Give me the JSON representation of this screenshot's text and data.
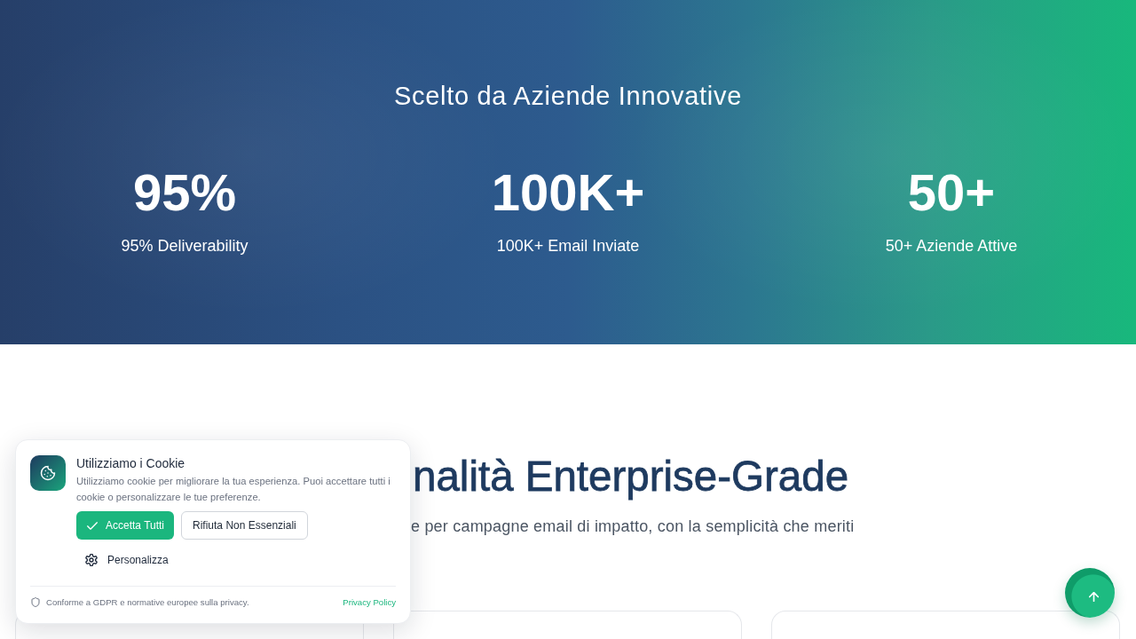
{
  "stats_section": {
    "title": "Scelto da Aziende Innovative",
    "stats": [
      {
        "value": "95%",
        "label": "95% Deliverability"
      },
      {
        "value": "100K+",
        "label": "100K+ Email Inviate"
      },
      {
        "value": "50+",
        "label": "50+ Aziende Attive"
      }
    ]
  },
  "features_section": {
    "title": "nalità Enterprise-Grade",
    "subtitle": "e per campagne email di impatto, con la semplicità che meriti"
  },
  "cookie_banner": {
    "title": "Utilizziamo i Cookie",
    "message": "Utilizziamo cookie per migliorare la tua esperienza. Puoi accettare tutti i cookie o personalizzare le tue preferenze.",
    "buttons": [
      {
        "label": "Accetta Tutti",
        "kind": "accept"
      },
      {
        "label": "Rifiuta Non Essenziali",
        "kind": "reject"
      },
      {
        "label": "Personalizza",
        "kind": "customize"
      }
    ],
    "compliance_note": "Conforme a GDPR e normative europee sulla privacy.",
    "privacy_link": "Privacy Policy"
  }
}
